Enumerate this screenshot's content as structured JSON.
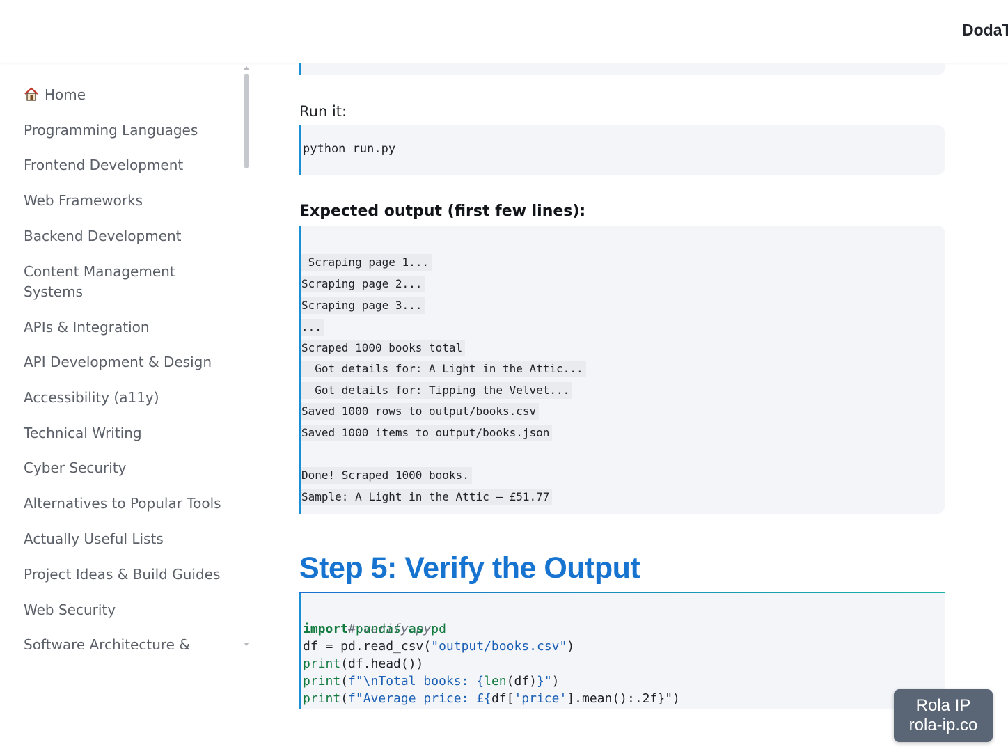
{
  "header": {
    "brand": "DodaT"
  },
  "sidebar": {
    "items": [
      {
        "label": "Home",
        "icon": "house-icon"
      },
      {
        "label": "Programming Languages"
      },
      {
        "label": "Frontend Development"
      },
      {
        "label": "Web Frameworks"
      },
      {
        "label": "Backend Development"
      },
      {
        "label": "Content Management Systems"
      },
      {
        "label": "APIs & Integration"
      },
      {
        "label": "API Development & Design"
      },
      {
        "label": "Accessibility (a11y)"
      },
      {
        "label": "Technical Writing"
      },
      {
        "label": "Cyber Security"
      },
      {
        "label": "Alternatives to Popular Tools"
      },
      {
        "label": "Actually Useful Lists"
      },
      {
        "label": "Project Ideas & Build Guides"
      },
      {
        "label": "Web Security"
      },
      {
        "label": "Software Architecture &"
      }
    ]
  },
  "main": {
    "run_label": "Run it:",
    "run_command": "python run.py",
    "expected_label": "Expected output (first few lines):",
    "output_lines": [
      " Scraping page 1...",
      "Scraping page 2...",
      "Scraping page 3...",
      "...",
      "Scraped 1000 books total",
      "  Got details for: A Light in the Attic...",
      "  Got details for: Tipping the Velvet...",
      "Saved 1000 rows to output/books.csv",
      "Saved 1000 items to output/books.json",
      "",
      "Done! Scraped 1000 books.",
      "Sample: A Light in the Attic – £51.77"
    ],
    "step_title": "Step 5: Verify the Output",
    "verify_code": {
      "comment": "# verify.py",
      "import_kw": "import",
      "import_mod": "pandas",
      "as_kw": "as",
      "alias": "pd",
      "line3_a": "df = pd.read_csv(",
      "line3_str": "\"output/books.csv\"",
      "line3_b": ")",
      "line4_fn": "print",
      "line4_rest": "(df.head())",
      "line5_fn": "print",
      "line5_a": "(",
      "line5_str1": "f\"\\nTotal books: {",
      "line5_len": "len",
      "line5_b": "(df)",
      "line5_str2": "}\"",
      "line5_c": ")",
      "line6_fn": "print",
      "line6_a": "(",
      "line6_str1": "f\"Average price: £{",
      "line6_b": "df[",
      "line6_str2": "'price'",
      "line6_c": "].mean():.2f}\")"
    }
  },
  "badge": {
    "line1": "Rola IP",
    "line2": "rola-ip.co"
  }
}
